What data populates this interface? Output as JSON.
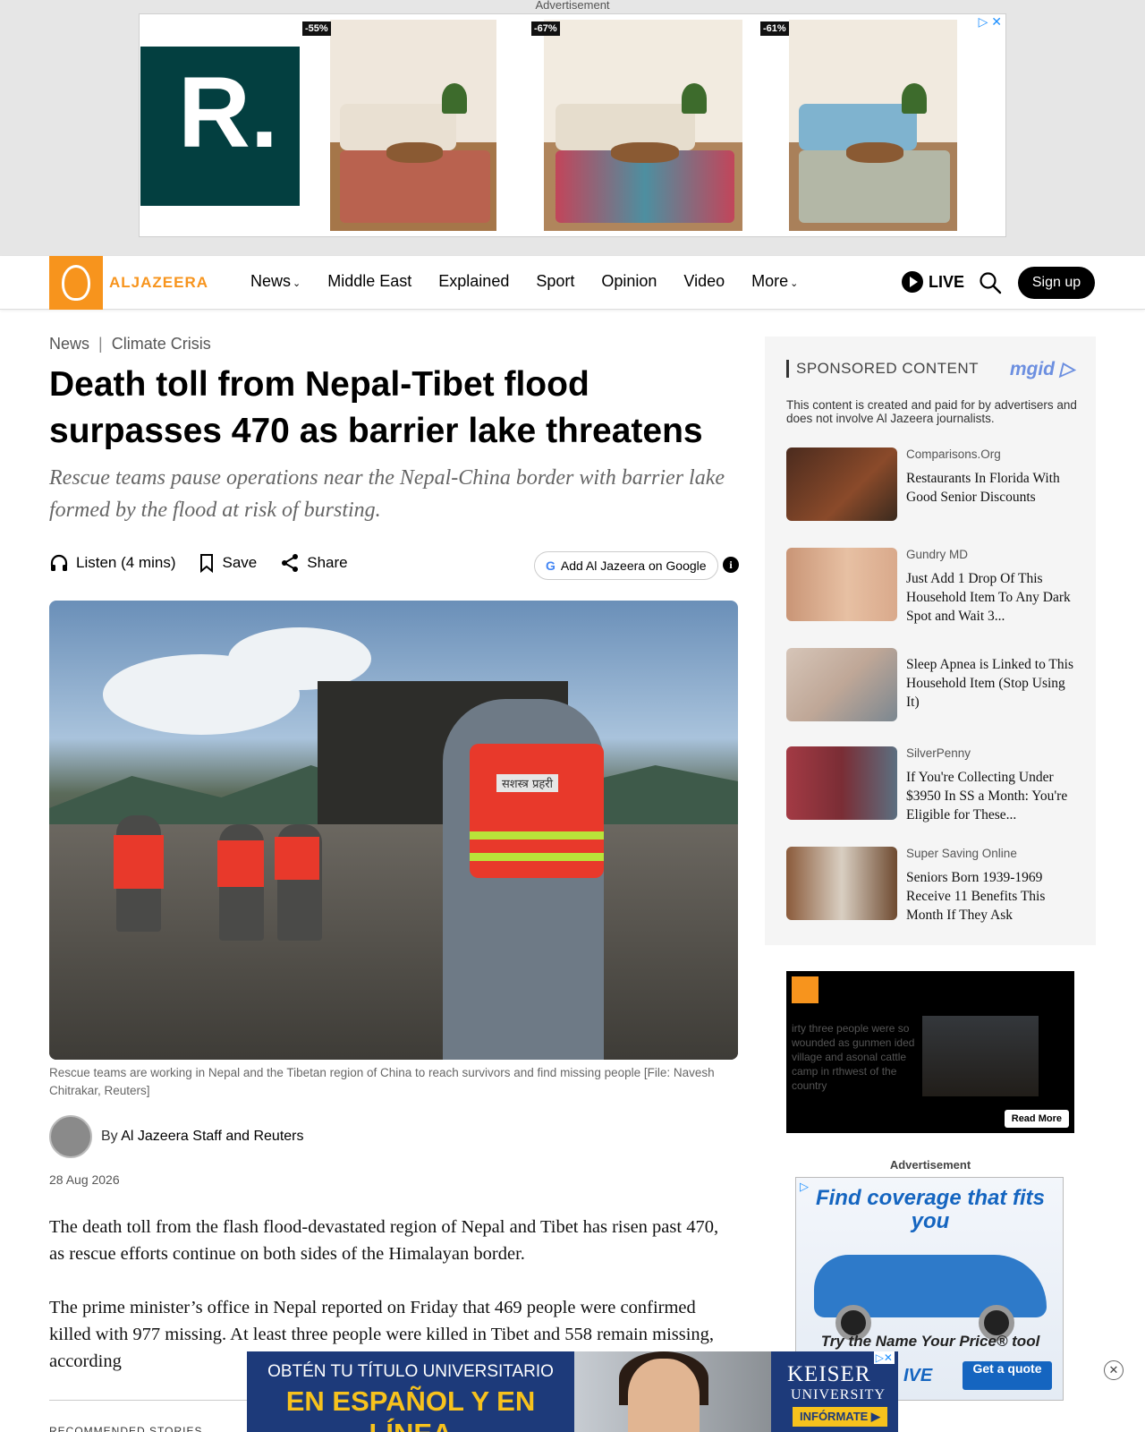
{
  "top_ad": {
    "label": "Advertisement",
    "brand_letter": "R.",
    "discounts": [
      "-55%",
      "-67%",
      "-61%"
    ],
    "adchoices": "▷ ✕",
    "colors": {
      "brand_bg": "#033f40",
      "brand_dot": "#0ec0b0"
    }
  },
  "header": {
    "logo_text": "ALJAZEERA",
    "nav": [
      {
        "label": "News",
        "has_menu": true
      },
      {
        "label": "Middle East",
        "has_menu": false
      },
      {
        "label": "Explained",
        "has_menu": false
      },
      {
        "label": "Sport",
        "has_menu": false
      },
      {
        "label": "Opinion",
        "has_menu": false
      },
      {
        "label": "Video",
        "has_menu": false
      },
      {
        "label": "More",
        "has_menu": true
      }
    ],
    "chevron": "⌄",
    "live_label": "LIVE",
    "signup_label": "Sign up",
    "icons": [
      "play-icon",
      "search-icon"
    ],
    "colors": {
      "brand": "#f7941d"
    }
  },
  "article": {
    "breadcrumb": {
      "section": "News",
      "separator": "|",
      "topic": "Climate Crisis"
    },
    "headline": "Death toll from Nepal-Tibet flood surpasses 470 as barrier lake threatens",
    "subhead": "Rescue teams pause operations near the Nepal-China border with barrier lake formed by the flood at risk of bursting.",
    "actions": {
      "listen": "Listen (4 mins)",
      "save": "Save",
      "share": "Share"
    },
    "google_button": "Add Al Jazeera on Google",
    "google_mark": "G",
    "info_glyph": "i",
    "vest_text": "सशस्त्र प्रहरी",
    "caption": "Rescue teams are working in Nepal and the Tibetan region of China to reach survivors and find missing people [File: Navesh Chitrakar, Reuters]",
    "author_prefix": "By",
    "author": "Al Jazeera Staff and Reuters",
    "date": "28 Aug 2026",
    "paragraphs": [
      "The death toll from the flash flood-devastated region of Nepal and Tibet has risen past 470, as rescue efforts continue on both sides of the Himalayan border.",
      "The prime minister’s office in Nepal reported on Friday that 469 people were confirmed killed with 977 missing. At least three people were killed in Tibet and 558 remain missing, according"
    ],
    "recommended_label": "RECOMMENDED STORIES"
  },
  "sponsored": {
    "heading": "SPONSORED CONTENT",
    "provider": "mgid ▷",
    "disclaimer": "This content is created and paid for by advertisers and does not involve Al Jazeera journalists.",
    "items": [
      {
        "source": "Comparisons.Org",
        "title": "Restaurants In Florida With Good Senior Discounts"
      },
      {
        "source": "Gundry MD",
        "title": "Just Add 1 Drop Of This Household Item To Any Dark Spot and Wait 3..."
      },
      {
        "source": "",
        "title": "Sleep Apnea is Linked to This Household Item (Stop Using It)"
      },
      {
        "source": "SilverPenny",
        "title": "If You're Collecting Under $3950 In SS a Month: You're Eligible for These..."
      },
      {
        "source": "Super Saving Online",
        "title": "Seniors Born 1939-1969 Receive 11 Benefits This Month If They Ask"
      }
    ]
  },
  "video_ad": {
    "overlay_text": "irty three people were so wounded as gunmen ided village and asonal cattle camp in rthwest of the country",
    "read_more": "Read More"
  },
  "car_ad": {
    "label": "Advertisement",
    "headline": "Find coverage that fits you",
    "tagline": "Try the Name Your Price® tool",
    "cta": "Get a quote",
    "partial_text": "IVE",
    "close_glyph": "✕",
    "colors": {
      "accent": "#1565c0",
      "car": "#2e7ac9"
    }
  },
  "bottom_ad": {
    "line1": "OBTÉN TU TÍTULO UNIVERSITARIO",
    "line2": "EN ESPAÑOL Y EN LÍNEA",
    "brand1": "KEISER",
    "brand2": "UNIVERSITY",
    "cta": "INFÓRMATE ▶",
    "colors": {
      "bg": "#1d3a7a",
      "highlight": "#f7c21d"
    }
  }
}
